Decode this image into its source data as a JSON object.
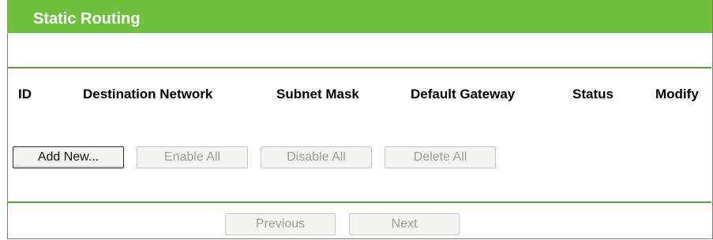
{
  "panel": {
    "title": "Static Routing"
  },
  "table": {
    "columns": [
      "ID",
      "Destination Network",
      "Subnet Mask",
      "Default Gateway",
      "Status",
      "Modify"
    ],
    "rows": []
  },
  "actions": {
    "add_new": "Add New...",
    "enable_all": "Enable All",
    "disable_all": "Disable All",
    "delete_all": "Delete All"
  },
  "pagination": {
    "previous": "Previous",
    "next": "Next"
  },
  "colors": {
    "title_bar": "#6fc03c",
    "divider": "#5a9f42"
  }
}
